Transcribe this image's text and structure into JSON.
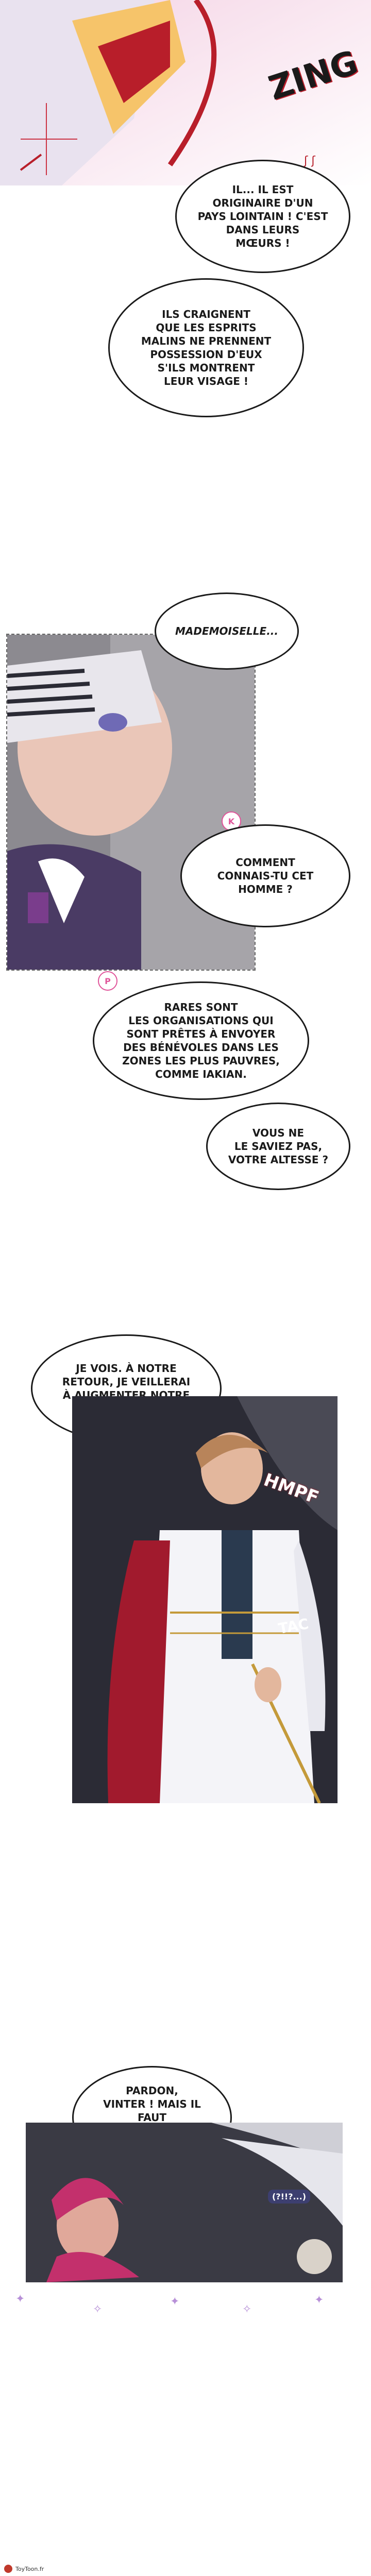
{
  "sfx": {
    "zing": "ZING",
    "hmpf": "HMPF",
    "tac": "TAC",
    "huh": "(?!!?...)"
  },
  "speech": {
    "b1": "IL... IL EST\nORIGINAIRE D'UN\nPAYS LOINTAIN ! C'EST\nDANS LEURS\nMŒURS !",
    "b2": "ILS CRAIGNENT\nQUE LES ESPRITS\nMALINS NE PRENNENT\nPOSSESSION D'EUX\nS'ILS MONTRENT\nLEUR VISAGE !",
    "b3": "MADEMOISELLE...",
    "b4": "COMMENT\nCONNAIS-TU CET\nHOMME ?",
    "b5": "RARES SONT\nLES ORGANISATIONS QUI\nSONT PRÊTES À ENVOYER\nDES BÉNÉVOLES DANS LES\nZONES LES PLUS PAUVRES,\nCOMME IAKIAN.",
    "b6": "VOUS NE\nLE SAVIEZ PAS,\nVOTRE ALTESSE ?",
    "b7": "JE VOIS. À NOTRE\nRETOUR, JE VEILLERAI\nÀ AUGMENTER NOTRE\nSOUTIEN.",
    "b8": "PARDON,\nVINTER ! MAIS IL FAUT\nPROTÉGER VOTRE\nSECRET !"
  },
  "tags": {
    "k": "K",
    "p": "P"
  },
  "footer": {
    "site": "ToyToon.fr"
  },
  "colors": {
    "accent_red": "#b81e2a",
    "purple": "#8e6bb8",
    "panel_dark": "#2b2b35"
  }
}
